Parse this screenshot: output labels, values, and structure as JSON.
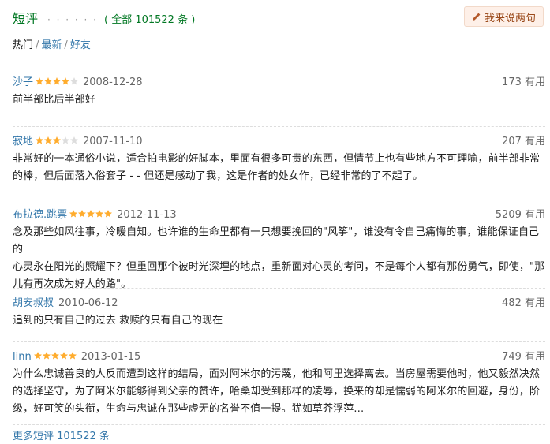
{
  "header": {
    "title": "短评",
    "dots": "· · · · · ·",
    "count": "( 全部 101522 条 )",
    "write_button": "我来说两句"
  },
  "filters": [
    {
      "label": "热门",
      "active": true
    },
    {
      "label": "最新",
      "active": false
    },
    {
      "label": "好友",
      "active": false
    }
  ],
  "filters_sep": "/",
  "reviews": [
    {
      "user": "沙子",
      "stars": 4,
      "date": "2008-12-28",
      "votes": "173 有用",
      "lines": [
        "前半部比后半部好"
      ]
    },
    {
      "user": "寂地",
      "stars": 3,
      "date": "2007-11-10",
      "votes": "207 有用",
      "lines": [
        "非常好的一本通俗小说，适合拍电影的好脚本，里面有很多可贵的东西，但情节上也有些地方不可理喻，前半部非常",
        "的棒，但后面落入俗套子 - - 但还是感动了我，这是作者的处女作，已经非常的了不起了。"
      ]
    },
    {
      "user": "布拉德.跳票",
      "stars": 5,
      "date": "2012-11-13",
      "votes": "5209 有用",
      "lines": [
        "念及那些如风往事，冷暖自知。也许谁的生命里都有一只想要挽回的\"风筝\"，谁没有令自己痛悔的事，谁能保证自己的",
        "心灵永在阳光的照耀下？但重回那个被时光深埋的地点，重新面对心灵的考问，不是每个人都有那份勇气，即使，\"那",
        "儿有再次成为好人的路\"。"
      ]
    },
    {
      "user": "胡安叔叔",
      "stars": 0,
      "date": "2010-06-12",
      "votes": "482 有用",
      "lines": [
        "追到的只有自己的过去 救赎的只有自己的现在"
      ]
    },
    {
      "user": "linn",
      "stars": 5,
      "date": "2013-01-15",
      "votes": "749 有用",
      "lines": [
        "为什么忠诚善良的人反而遭到这样的结局，面对阿米尔的污蔑，他和阿里选择离去。当房屋需要他时，他又毅然决然",
        "的选择坚守，为了阿米尔能够得到父亲的赞许，哈桑却受到那样的凌辱，换来的却是懦弱的阿米尔的回避，身份，阶",
        "级，好可笑的头衔，生命与忠诚在那些虚无的名誉不值一提。犹如草芥浮萍…"
      ]
    }
  ],
  "more_link": "更多短评 101522 条",
  "colors": {
    "green": "#007722",
    "link": "#3377aa",
    "star": "#ffac2d",
    "star_empty": "#dddddd",
    "button_bg": "#fef0e8"
  }
}
